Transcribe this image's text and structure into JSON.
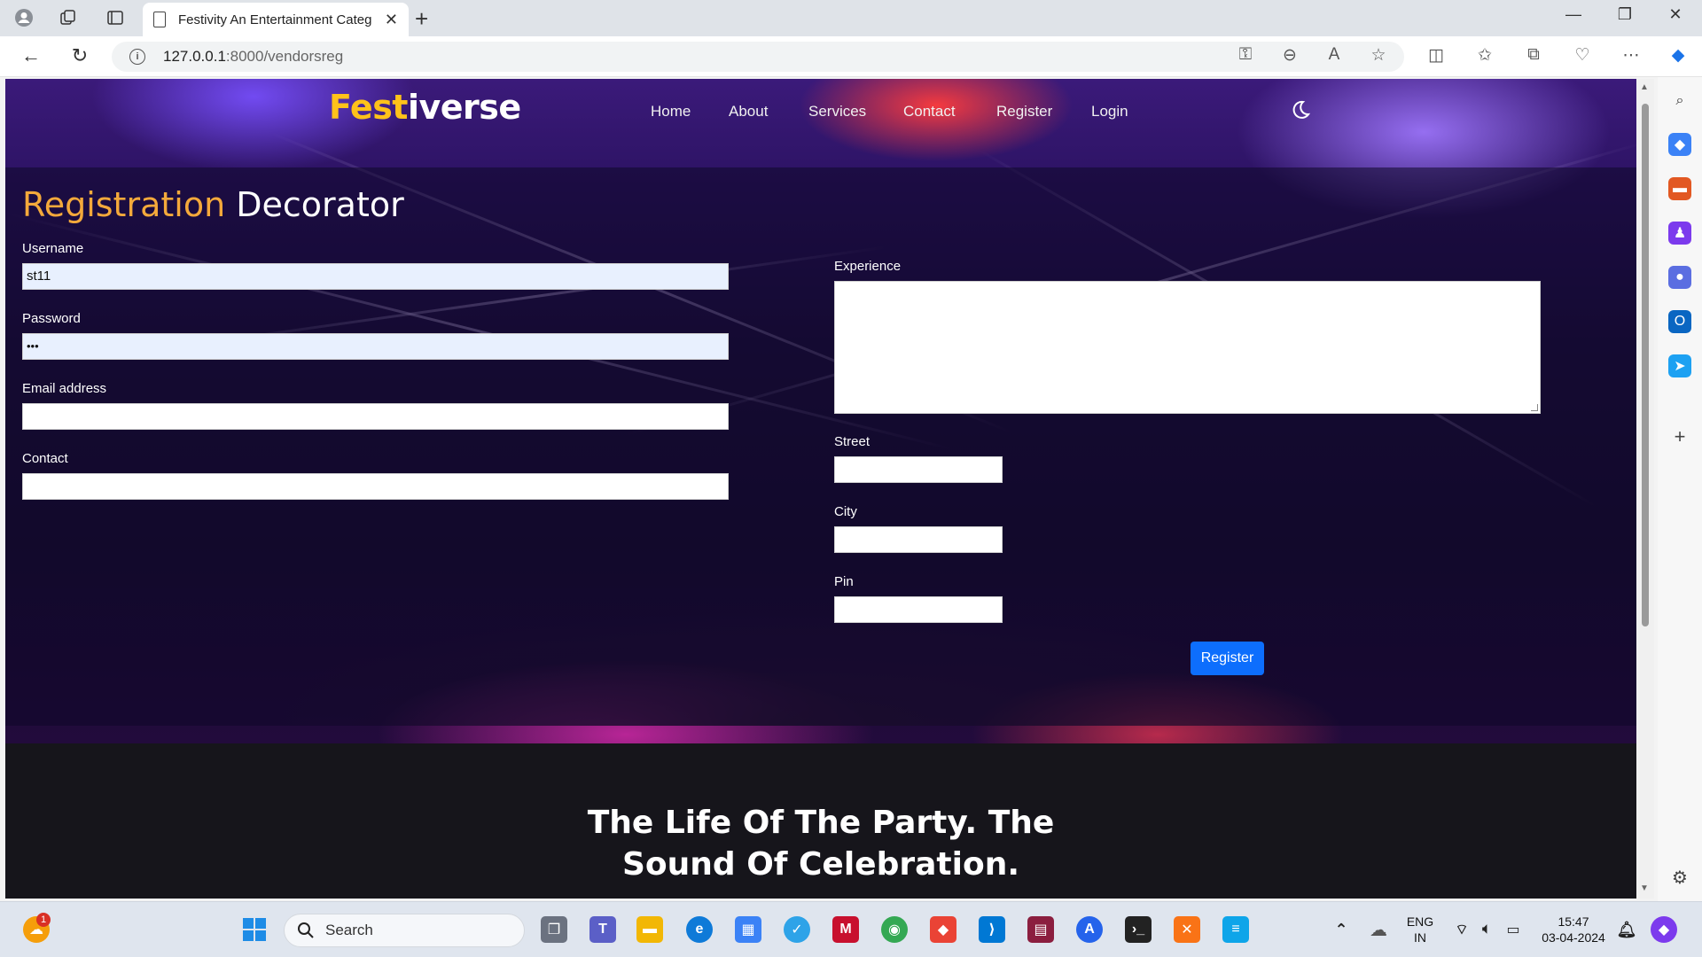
{
  "browser": {
    "tab_title": "Festivity An Entertainment Categ",
    "url_host": "127.0.0.1",
    "url_path": ":8000/vendorsreg"
  },
  "site": {
    "brand_part1": "Fest",
    "brand_part2": "iverse",
    "nav": [
      "Home",
      "About",
      "Services",
      "Contact",
      "Register",
      "Login"
    ]
  },
  "form": {
    "heading_part1": "Registration",
    "heading_part2": "Decorator",
    "username_label": "Username",
    "username_value": "st11",
    "password_label": "Password",
    "password_value": "•••",
    "email_label": "Email address",
    "contact_label": "Contact",
    "experience_label": "Experience",
    "street_label": "Street",
    "city_label": "City",
    "pin_label": "Pin",
    "submit_label": "Register"
  },
  "footer": {
    "tagline_line1": "The Life Of The Party. The",
    "tagline_line2": "Sound Of Celebration."
  },
  "taskbar": {
    "search_placeholder": "Search",
    "weather_badge": "1",
    "lang_line1": "ENG",
    "lang_line2": "IN",
    "time": "15:47",
    "date": "03-04-2024"
  },
  "colors": {
    "brand_yellow": "#ffc21a",
    "heading_orange": "#f4a93b",
    "button_blue": "#0d6efd",
    "footer_bg": "#16151b"
  }
}
